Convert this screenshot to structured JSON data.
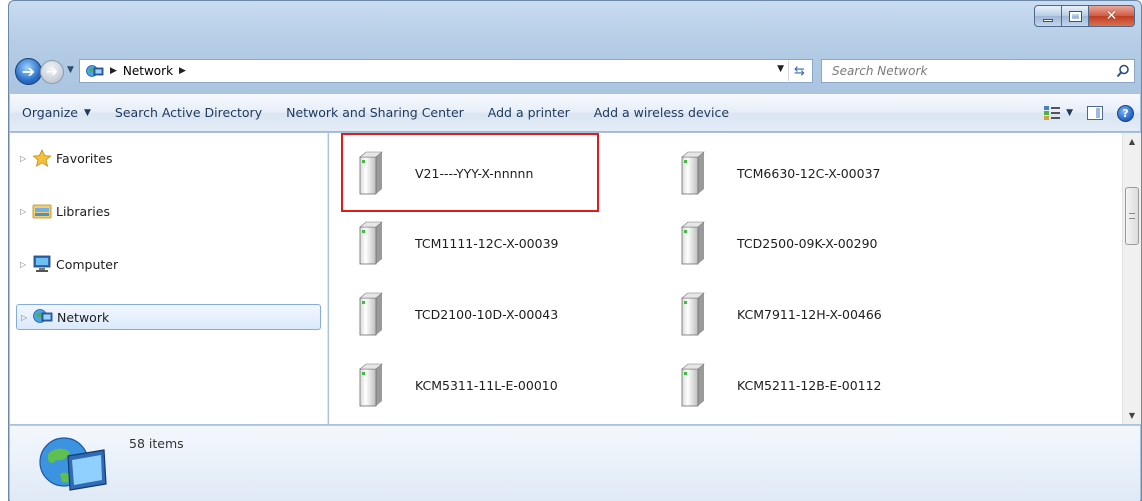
{
  "window": {
    "caption_buttons": [
      "minimize",
      "maximize",
      "close"
    ]
  },
  "address": {
    "crumbs": [
      "Network"
    ],
    "search_placeholder": "Search Network"
  },
  "commands": {
    "organize": "Organize",
    "search_ad": "Search Active Directory",
    "sharing_center": "Network and Sharing Center",
    "add_printer": "Add a printer",
    "add_wireless": "Add a wireless device"
  },
  "nav": {
    "items": [
      {
        "label": "Favorites",
        "icon": "star-icon"
      },
      {
        "label": "Libraries",
        "icon": "libraries-icon"
      },
      {
        "label": "Computer",
        "icon": "computer-icon"
      },
      {
        "label": "Network",
        "icon": "network-icon",
        "selected": true
      }
    ]
  },
  "content": {
    "items": [
      {
        "label": "V21----YYY-X-nnnnn",
        "highlighted": true
      },
      {
        "label": "TCM6630-12C-X-00037"
      },
      {
        "label": "TCM1111-12C-X-00039"
      },
      {
        "label": "TCD2500-09K-X-00290"
      },
      {
        "label": "TCD2100-10D-X-00043"
      },
      {
        "label": "KCM7911-12H-X-00466"
      },
      {
        "label": "KCM5311-11L-E-00010"
      },
      {
        "label": "KCM5211-12B-E-00112"
      }
    ]
  },
  "details": {
    "count": "58 items"
  },
  "colors": {
    "highlight_border": "#e11b1b",
    "selection_border": "#84acdd"
  }
}
